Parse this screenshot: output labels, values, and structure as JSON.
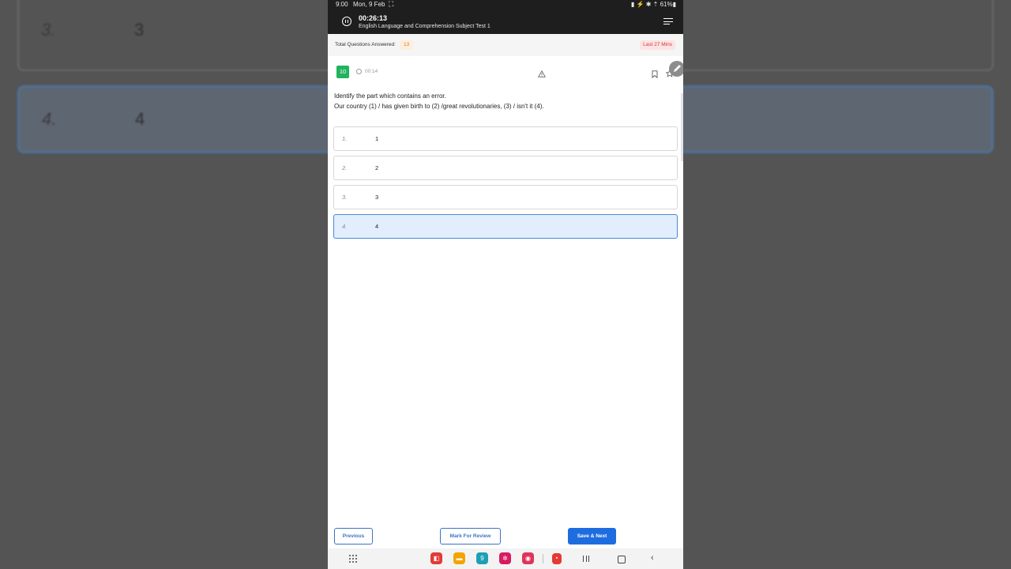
{
  "background": {
    "cards": [
      {
        "number": "3.",
        "value": "3"
      },
      {
        "number": "4.",
        "value": "4"
      }
    ]
  },
  "status_bar": {
    "time": "9:00",
    "date": "Mon, 9 Feb",
    "scan_glyph": "⛶",
    "right": "▮ ⚡ ✱ ⇡ 61%▮"
  },
  "header": {
    "timer": "00:26:13",
    "test_name": "English Language and Comprehension Subject Test 1",
    "icons": [
      "pause-icon",
      "menu-icon"
    ]
  },
  "summary": {
    "answered_label": "Total Questions Answered:",
    "answered_count": "13",
    "last_mins": "Last 27 Mins"
  },
  "question": {
    "number": "10",
    "elapsed": "00:14",
    "instruction": "Identify the part which contains an error.",
    "sentence": "Our country (1) / has given birth to (2) /great revolutionaries, (3) / isn't it (4).",
    "icons": [
      "clock-icon",
      "warning-icon",
      "bookmark-icon",
      "star-icon",
      "pen-icon"
    ]
  },
  "options": [
    {
      "number": "1.",
      "label": "1",
      "selected": false
    },
    {
      "number": "2.",
      "label": "2",
      "selected": false
    },
    {
      "number": "3.",
      "label": "3",
      "selected": false
    },
    {
      "number": "4.",
      "label": "4",
      "selected": true
    }
  ],
  "actions": {
    "previous": "Previous",
    "mark_for_review": "Mark For Review",
    "save_next": "Save & Next"
  },
  "nav": {
    "apps": [
      {
        "name": "flipboard-app-icon",
        "color": "#e53935",
        "glyph": "◧"
      },
      {
        "name": "files-app-icon",
        "color": "#f4a300",
        "glyph": "▬"
      },
      {
        "name": "calendar-app-icon",
        "color": "#1ea0b4",
        "glyph": "9"
      },
      {
        "name": "bixby-app-icon",
        "color": "#d81b60",
        "glyph": "✲"
      },
      {
        "name": "camera-app-icon",
        "color": "#e0345a",
        "glyph": "◉"
      },
      {
        "name": "recent-app-icon",
        "color": "#e53935",
        "glyph": "▪"
      }
    ]
  },
  "colors": {
    "accent": "#1e6de0",
    "question_badge": "#22b35e",
    "selected_bg": "#e3eefc",
    "warning_text": "#d03a3a",
    "count_text": "#d9822b"
  }
}
